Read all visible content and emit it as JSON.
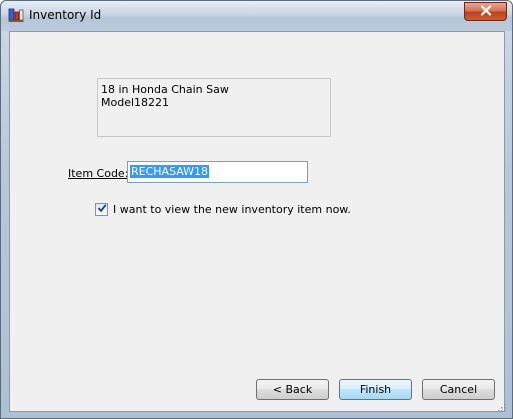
{
  "window": {
    "title": "Inventory Id"
  },
  "description": {
    "line1": "18 in Honda Chain Saw",
    "line2": "Model18221"
  },
  "item_code": {
    "label": "Item Code:",
    "value": "RECHASAW18"
  },
  "view_new_item": {
    "label": "I want to view the new inventory item now.",
    "checked": true
  },
  "buttons": {
    "back_label": "< Back",
    "finish_label": "Finish",
    "cancel_label": "Cancel"
  },
  "colors": {
    "accent_selection": "#3399ff",
    "default_button_border": "#3c7fb1",
    "close_button": "#c0411c"
  },
  "icons": {
    "app": "inventory-app-icon",
    "close": "close-icon",
    "check": "checkmark-icon",
    "grip": "resize-grip-icon"
  }
}
